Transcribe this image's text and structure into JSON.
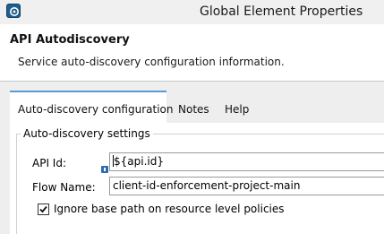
{
  "window": {
    "title": "Global Element Properties",
    "app_icon": "anypoint-studio-icon"
  },
  "header": {
    "title": "API Autodiscovery",
    "description": "Service auto-discovery configuration information."
  },
  "tabs": [
    {
      "label": "Auto-discovery configuration",
      "active": true
    },
    {
      "label": "Notes",
      "active": false
    },
    {
      "label": "Help",
      "active": false
    }
  ],
  "settings": {
    "group_label": "Auto-discovery settings",
    "api_id": {
      "label": "API Id:",
      "value": "${api.id}",
      "icon": "info-icon"
    },
    "flow_name": {
      "label": "Flow Name:",
      "value": "client-id-enforcement-project-main"
    },
    "ignore_base_path": {
      "label": "Ignore base path on resource level policies",
      "checked": true
    }
  },
  "colors": {
    "tab_accent": "#5b9bd5",
    "content_bg": "#eeeeee"
  }
}
